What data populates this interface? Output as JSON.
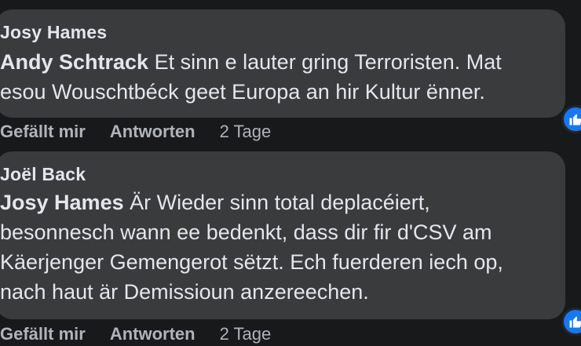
{
  "comments": [
    {
      "author": "Josy Hames",
      "mention": "Andy Schtrack",
      "text": " Et sinn e lauter gring Terroristen. Mat esou Wouschtbéck geet Europa an hir Kultur ënner.",
      "actions": {
        "like": "Gefällt mir",
        "reply": "Antworten",
        "time": "2 Tage"
      },
      "reaction_icon": "thumbs-up-icon"
    },
    {
      "author": "Joël Back",
      "mention": "Josy Hames",
      "text": " Är Wieder sinn total deplacéiert, besonnesch wann ee bedenkt, dass dir fir d'CSV am Käerjenger Gemengerot sëtzt. Ech fuerderen iech op, nach haut är Demissioun anzereechen.",
      "actions": {
        "like": "Gefällt mir",
        "reply": "Antworten",
        "time": "2 Tage"
      },
      "reaction_icon": "thumbs-up-icon"
    }
  ],
  "colors": {
    "background": "#18191a",
    "bubble": "#3a3b3c",
    "text": "#e4e6eb",
    "secondary_text": "#b0b3b8",
    "like_blue": "#1877f2"
  }
}
